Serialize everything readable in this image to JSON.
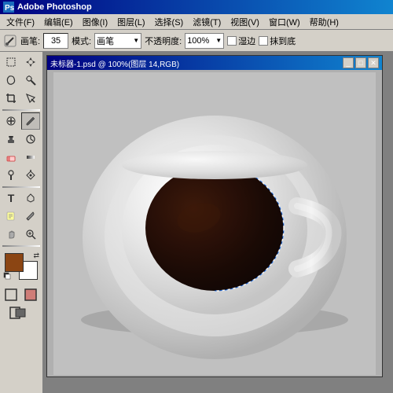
{
  "app": {
    "title": "Adobe Photoshop",
    "icon": "Ps"
  },
  "menu": {
    "items": [
      "文件(F)",
      "编辑(E)",
      "图像(I)",
      "图层(L)",
      "选择(S)",
      "滤镜(T)",
      "视图(V)",
      "窗口(W)",
      "帮助(H)"
    ]
  },
  "options_bar": {
    "tool_label": "画笔:",
    "brush_size": "35",
    "mode_label": "模式:",
    "mode_value": "画笔",
    "opacity_label": "不透明度:",
    "opacity_value": "100%",
    "wet_edges_label": "湿边",
    "airbrush_label": "抹到底"
  },
  "document": {
    "title": "未标器-1.psd @ 100%(图层 14,RGB)",
    "controls": [
      "_",
      "□",
      "✕"
    ]
  },
  "tools": [
    {
      "name": "marquee",
      "icon": "⬚",
      "active": false
    },
    {
      "name": "move",
      "icon": "✛",
      "active": false
    },
    {
      "name": "lasso",
      "icon": "𝓛",
      "active": false
    },
    {
      "name": "magic-wand",
      "icon": "✦",
      "active": false
    },
    {
      "name": "crop",
      "icon": "⊡",
      "active": false
    },
    {
      "name": "slice",
      "icon": "◈",
      "active": false
    },
    {
      "name": "healing",
      "icon": "⊕",
      "active": false
    },
    {
      "name": "brush",
      "icon": "✏",
      "active": true
    },
    {
      "name": "stamp",
      "icon": "▣",
      "active": false
    },
    {
      "name": "history",
      "icon": "◑",
      "active": false
    },
    {
      "name": "eraser",
      "icon": "⬜",
      "active": false
    },
    {
      "name": "gradient",
      "icon": "▦",
      "active": false
    },
    {
      "name": "dodge",
      "icon": "○",
      "active": false
    },
    {
      "name": "pen",
      "icon": "✒",
      "active": false
    },
    {
      "name": "text",
      "icon": "T",
      "active": false
    },
    {
      "name": "shape",
      "icon": "✡",
      "active": false
    },
    {
      "name": "notes",
      "icon": "🗒",
      "active": false
    },
    {
      "name": "eyedropper",
      "icon": "✍",
      "active": false
    },
    {
      "name": "hand",
      "icon": "☚",
      "active": false
    },
    {
      "name": "zoom",
      "icon": "🔍",
      "active": false
    }
  ],
  "colors": {
    "foreground": "#8B4513",
    "background": "#ffffff"
  }
}
